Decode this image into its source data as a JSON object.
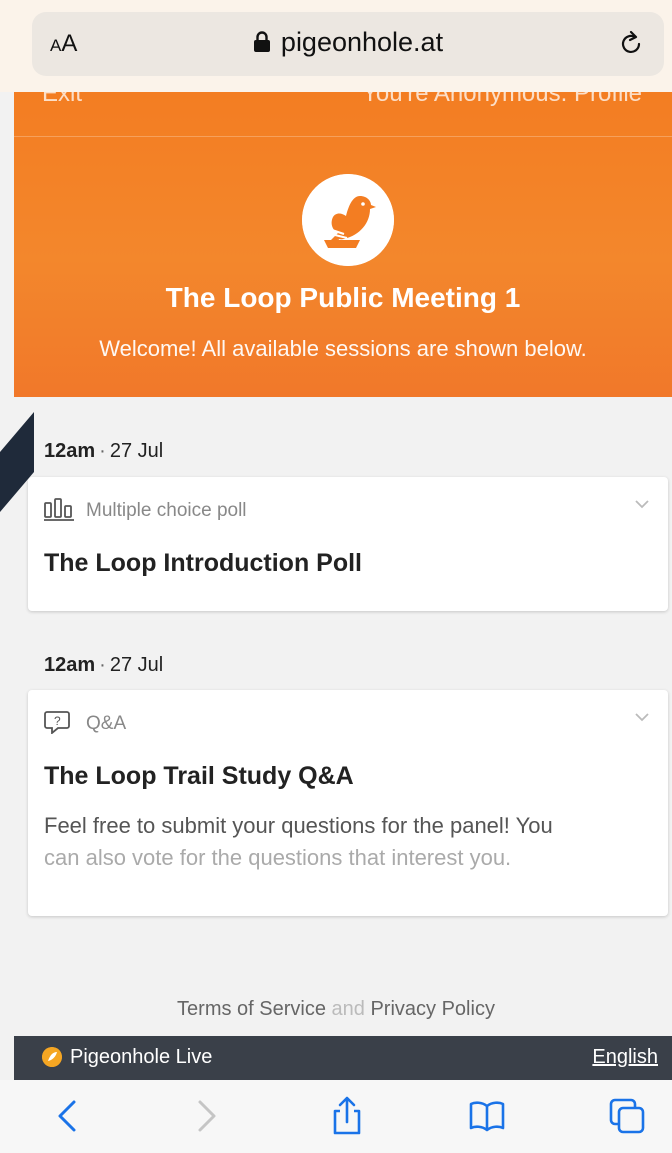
{
  "browser": {
    "text_size_label": "AA",
    "url": "pigeonhole.at",
    "icons": [
      "lock-icon",
      "reload-icon"
    ]
  },
  "header": {
    "exit_label": "Exit",
    "anonymous_label": "You're Anonymous. Profile",
    "event_title": "The Loop Public Meeting 1",
    "welcome_text": "Welcome! All available sessions are shown below.",
    "brand_color": "#f37d22"
  },
  "sessions": [
    {
      "time": "12am",
      "date": "27 Jul",
      "type": "Multiple choice poll",
      "type_icon": "poll-icon",
      "title": "The Loop Introduction Poll"
    },
    {
      "time": "12am",
      "date": "27 Jul",
      "type": "Q&A",
      "type_icon": "qa-icon",
      "title": "The Loop Trail Study Q&A",
      "description_line1": "Feel free to submit your questions for the panel! You",
      "description_line2": "can also vote for the questions that interest you."
    }
  ],
  "footer": {
    "terms": "Terms of Service",
    "and": "and",
    "privacy": "Privacy Policy",
    "brand": "Pigeonhole Live",
    "language": "English",
    "bar_color": "#3a4049"
  },
  "toolbar": {
    "icons": [
      "back-icon",
      "forward-icon",
      "share-icon",
      "bookmarks-icon",
      "tabs-icon"
    ],
    "accent": "#1a73e8"
  }
}
